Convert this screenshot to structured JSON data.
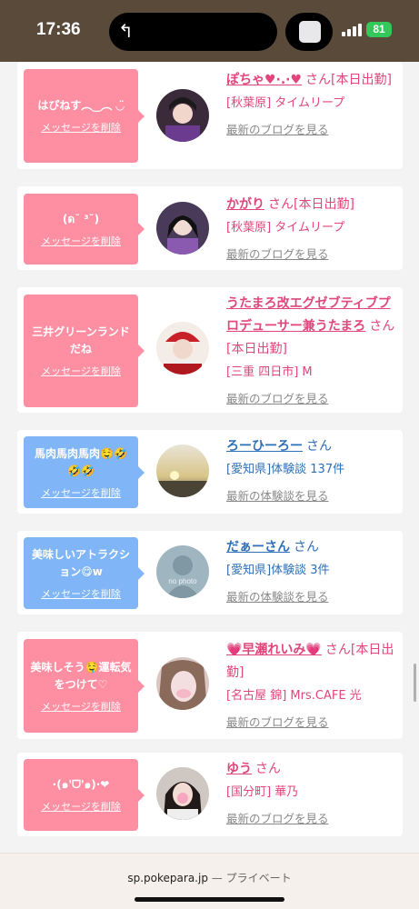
{
  "status": {
    "time": "17:36",
    "battery": "81"
  },
  "browser": {
    "domain": "sp.pokepara.jp",
    "mode": "— プライベート"
  },
  "cards": [
    {
      "bubble_color": "#fe8fa3",
      "message": "はぴねす︵‿︵ ◡̈",
      "delete_label": "メッセージを削除",
      "name": "ぽちゃ♥·.·♥",
      "san": "さん[本日出勤]",
      "area": "[秋葉原] タイムリープ",
      "link": "最新のブログを見る",
      "type": "cast"
    },
    {
      "bubble_color": "#fe8fa3",
      "message": "(ด˘ ³˘)",
      "delete_label": "メッセージを削除",
      "name": "かがり",
      "san": "さん[本日出勤]",
      "area": "[秋葉原] タイムリープ",
      "link": "最新のブログを見る",
      "type": "cast"
    },
    {
      "bubble_color": "#fe8fa3",
      "message": "三井グリーンランドだね",
      "delete_label": "メッセージを削除",
      "name": "うたまろ改エグゼブティブプロデューサー兼うたまろ",
      "san": "さん[本日出勤]",
      "area": "[三重 四日市] M",
      "link": "最新のブログを見る",
      "type": "cast"
    },
    {
      "bubble_color": "#80b6f7",
      "message": "馬肉馬肉馬肉🤤🤣🤣🤣",
      "delete_label": "メッセージを削除",
      "name": "ろーひーろー",
      "san": "さん",
      "area": "[愛知県]体験談 137件",
      "link": "最新の体験談を見る",
      "type": "user"
    },
    {
      "bubble_color": "#80b6f7",
      "message": "美味しいアトラクション😋w",
      "delete_label": "メッセージを削除",
      "name": "だぁーさん",
      "san": "さん",
      "area": "[愛知県]体験談 3件",
      "link": "最新の体験談を見る",
      "type": "user"
    },
    {
      "bubble_color": "#fe8fa3",
      "message": "美味しそう🤤運転気をつけて♡",
      "delete_label": "メッセージを削除",
      "name": "💗早瀬れいみ💗",
      "san": "さん[本日出勤]",
      "area": "[名古屋 錦] Mrs.CAFE 光",
      "link": "最新のブログを見る",
      "type": "cast"
    },
    {
      "bubble_color": "#fe8fa3",
      "message": "·(๑'ᗜ'๑)·❤",
      "delete_label": "メッセージを削除",
      "name": "ゆう",
      "san": "さん",
      "area": "[国分町] 華乃",
      "link": "最新のブログを見る",
      "type": "cast"
    }
  ]
}
